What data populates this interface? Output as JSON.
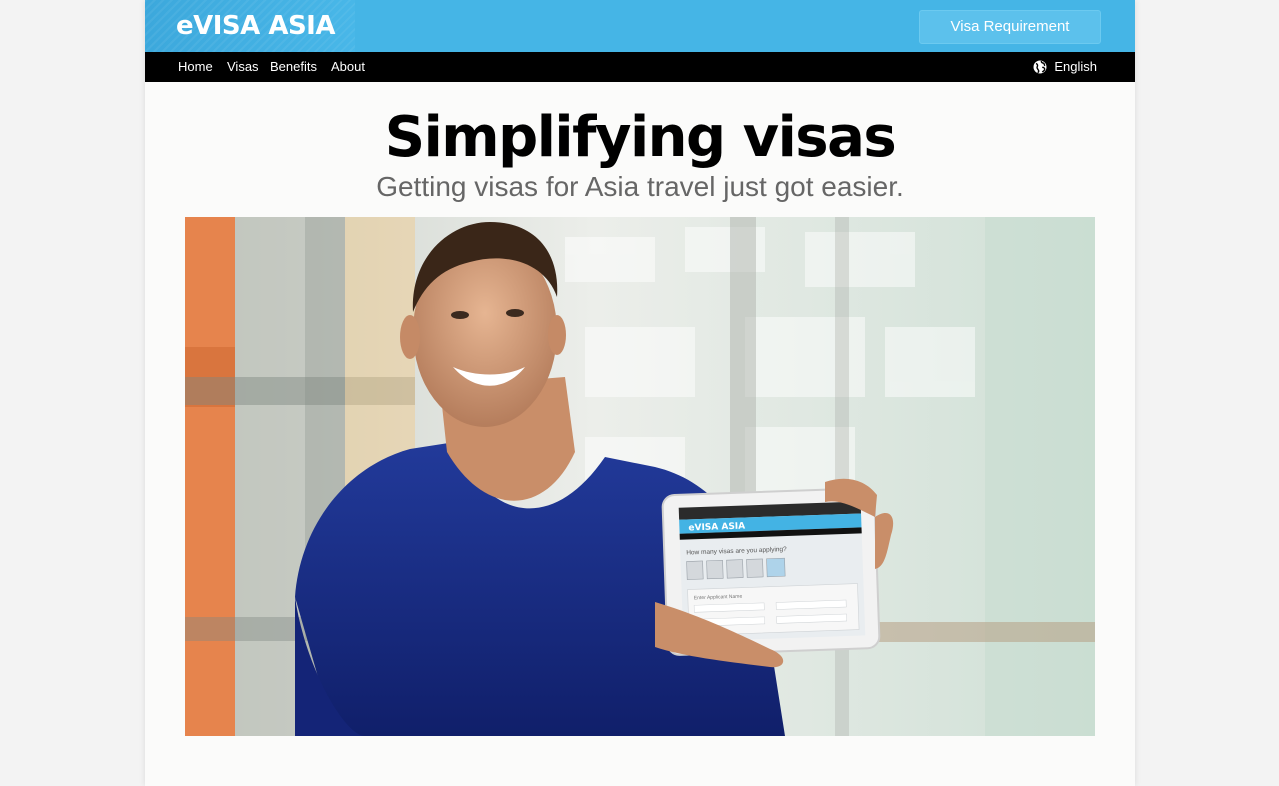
{
  "header": {
    "logo_text": "eVISA ASIA",
    "cta_label": "Visa Requirement",
    "brand_color": "#45b5e6"
  },
  "nav": {
    "items": [
      {
        "label": "Home"
      },
      {
        "label": "Visas"
      },
      {
        "label": "Benefits"
      },
      {
        "label": "About"
      }
    ],
    "language": "English"
  },
  "hero": {
    "title": "Simplifying visas",
    "subtitle": "Getting visas for Asia travel just got easier.",
    "photo_subject": "smiling man in blue t-shirt holding tablet showing the eVisa Asia site"
  },
  "tablet_screen": {
    "logo_text": "eVISA ASIA",
    "question": "How many visas are you applying?",
    "applicant_label": "Enter Applicant Name"
  }
}
